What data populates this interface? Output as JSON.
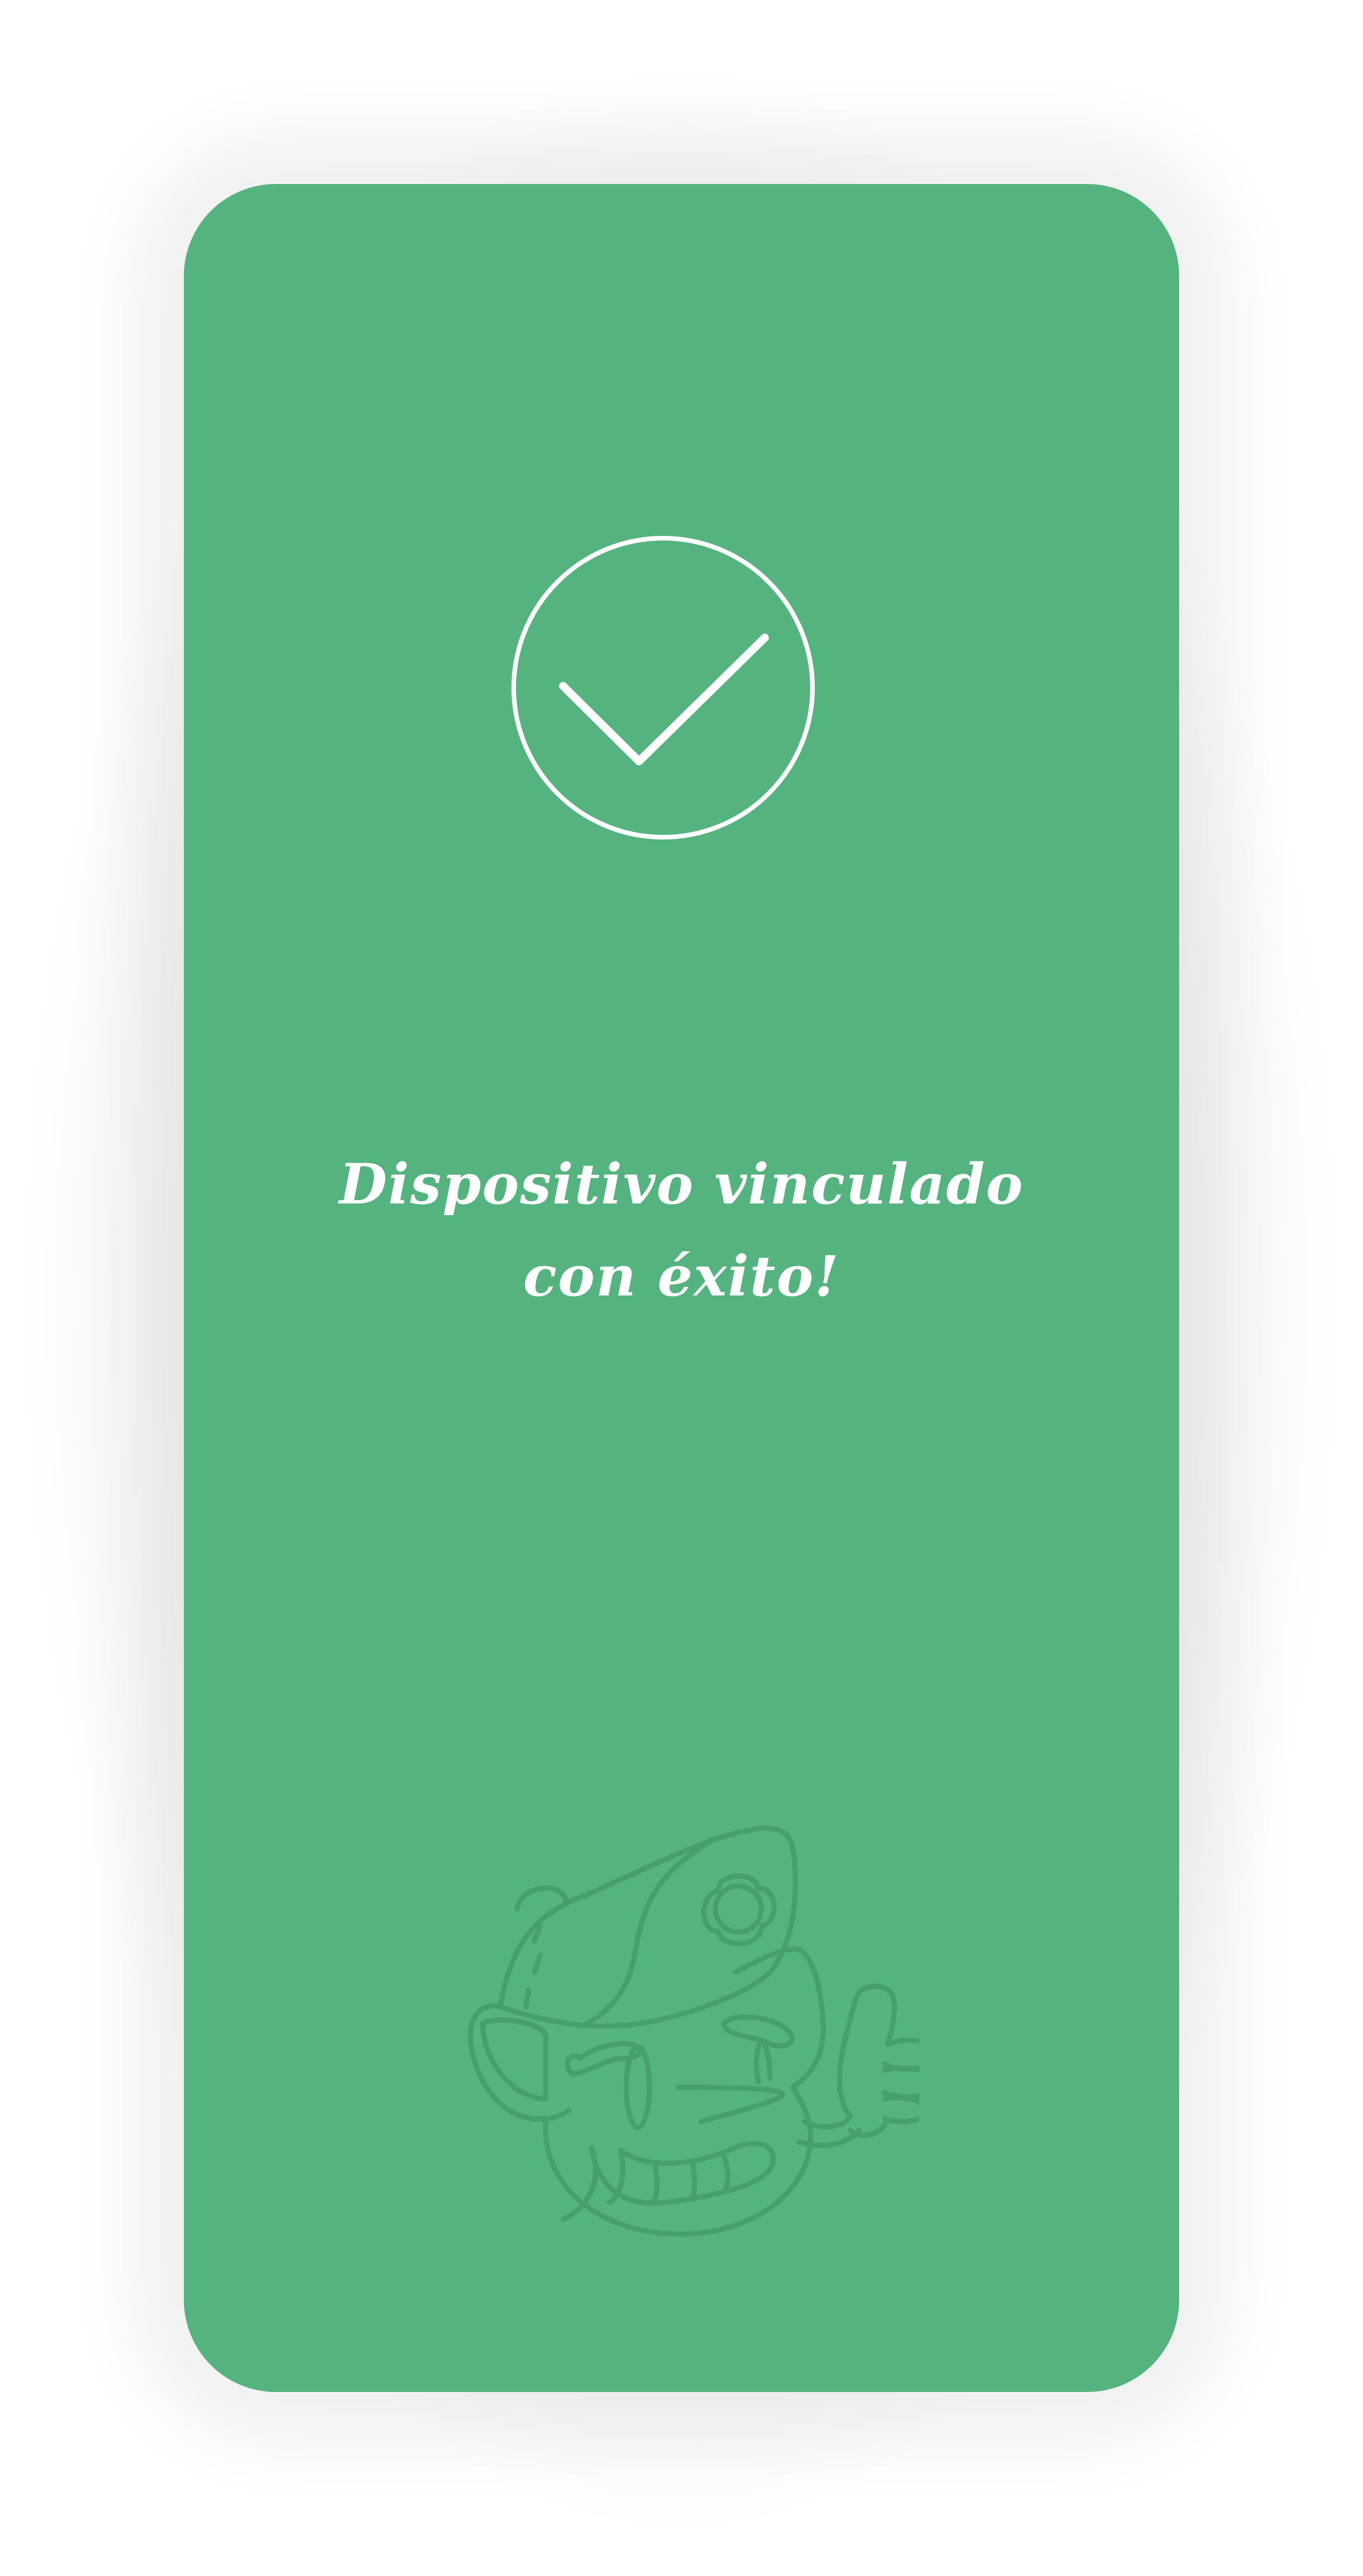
{
  "success": {
    "line1": "Dispositivo vinculado",
    "line2": "con éxito!"
  },
  "colors": {
    "card_background": "#54b37e",
    "check_stroke": "#ffffff",
    "mascot_line": "#46a06d"
  },
  "icons": {
    "status": "check-circle-icon",
    "illustration": "mascot-thumbs-up-illustration"
  }
}
